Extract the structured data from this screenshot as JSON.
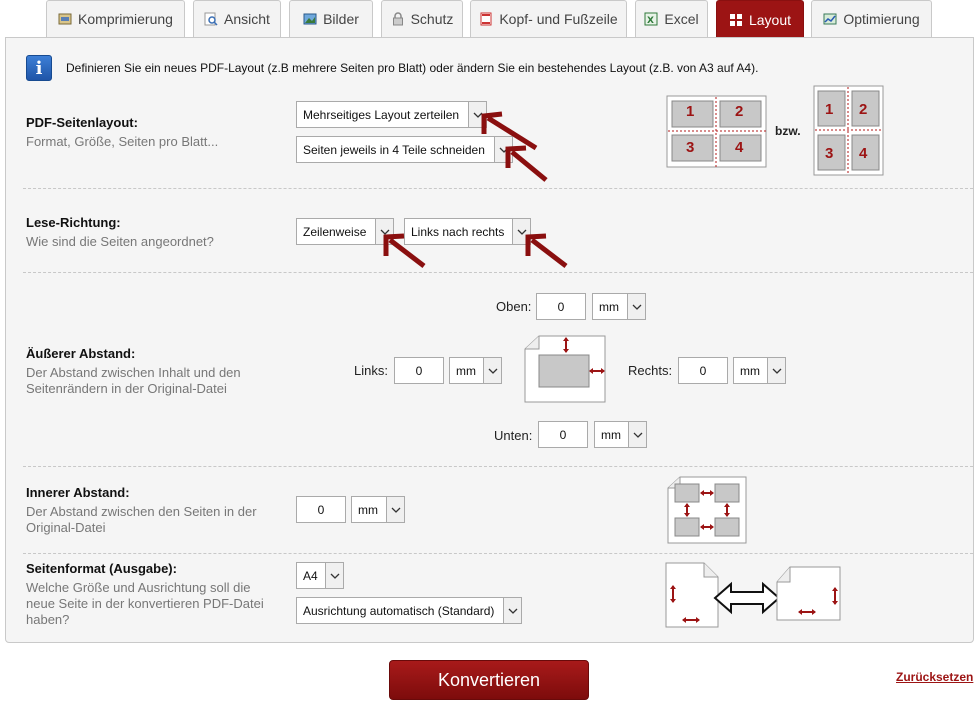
{
  "tabs": [
    {
      "label": "Komprimierung",
      "icon": "compress-icon"
    },
    {
      "label": "Ansicht",
      "icon": "magnifier-icon"
    },
    {
      "label": "Bilder",
      "icon": "image-icon"
    },
    {
      "label": "Schutz",
      "icon": "lock-icon"
    },
    {
      "label": "Kopf- und Fußzeile",
      "icon": "header-footer-icon"
    },
    {
      "label": "Excel",
      "icon": "excel-icon"
    },
    {
      "label": "Layout",
      "icon": "layout-icon"
    },
    {
      "label": "Optimierung",
      "icon": "optimize-icon"
    }
  ],
  "active_tab": "Layout",
  "info": {
    "text": "Definieren Sie ein neues PDF-Layout (z.B mehrere Seiten pro Blatt) oder ändern Sie ein bestehendes Layout (z.B. von A3 auf A4)."
  },
  "page_layout": {
    "title": "PDF-Seitenlayout:",
    "desc": "Format, Größe, Seiten pro Blatt...",
    "select1": "Mehrseitiges Layout zerteilen",
    "select2": "Seiten jeweils in 4 Teile schneiden",
    "diagram_numbers": [
      "1",
      "2",
      "3",
      "4"
    ],
    "bzw": "bzw."
  },
  "reading": {
    "title": "Lese-Richtung:",
    "desc": "Wie sind die Seiten angeordnet?",
    "select1": "Zeilenweise",
    "select2": "Links nach rechts"
  },
  "outer_margin": {
    "title": "Äußerer Abstand:",
    "desc_line1": "Der Abstand zwischen Inhalt und den",
    "desc_line2": "Seitenrändern in der Original-Datei",
    "top_label": "Oben:",
    "top_value": "0",
    "top_unit": "mm",
    "left_label": "Links:",
    "left_value": "0",
    "left_unit": "mm",
    "right_label": "Rechts:",
    "right_value": "0",
    "right_unit": "mm",
    "bottom_label": "Unten:",
    "bottom_value": "0",
    "bottom_unit": "mm"
  },
  "inner_margin": {
    "title": "Innerer Abstand:",
    "desc_line1": "Der Abstand zwischen den Seiten in der",
    "desc_line2": "Original-Datei",
    "value": "0",
    "unit": "mm"
  },
  "output_format": {
    "title": "Seitenformat (Ausgabe):",
    "desc_line1": "Welche Größe und Ausrichtung soll die",
    "desc_line2": "neue Seite in der konvertieren PDF-Datei",
    "desc_line3": "haben?",
    "size": "A4",
    "orientation": "Ausrichtung automatisch (Standard)"
  },
  "convert_label": "Konvertieren",
  "reset_label": "Zurücksetzen",
  "colors": {
    "accent": "#9c1414",
    "panel_bg": "#f5f5f5",
    "info_blue": "#2a66bb"
  }
}
